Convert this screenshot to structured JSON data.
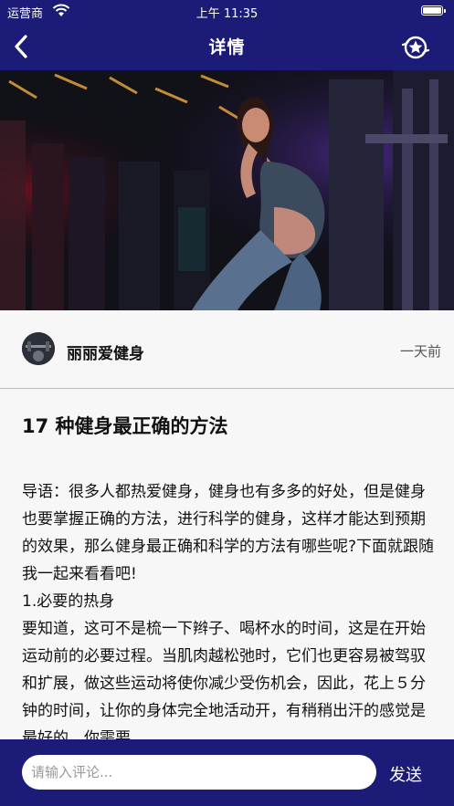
{
  "status_bar": {
    "carrier": "运营商",
    "time": "上午 11:35"
  },
  "nav": {
    "title": "详情",
    "back_icon": "chevron-left-icon",
    "favorite_icon": "star-badge-icon"
  },
  "post": {
    "author": "丽丽爱健身",
    "time_ago": "一天前",
    "title": "17 种健身最正确的方法",
    "body": [
      "导语：很多人都热爱健身，健身也有多多的好处，但是健身也要掌握正确的方法，进行科学的健身，这样才能达到预期的效果，那么健身最正确和科学的方法有哪些呢?下面就跟随我一起来看看吧!",
      "1.必要的热身",
      "要知道，这可不是梳一下辫子、喝杯水的时间，这是在开始运动前的必要过程。当肌肉越松弛时，它们也更容易被驾驭和扩展，做这些运动将使你减少受伤机会，因此，花上５分钟的时间，让你的身体完全地活动开，有稍稍出汗的感觉是最好的，你需要"
    ]
  },
  "comment": {
    "placeholder": "请输入评论...",
    "value": "",
    "send_label": "发送"
  },
  "colors": {
    "brand": "#1c1c78",
    "background": "#f7f7f7",
    "text": "#111111"
  }
}
